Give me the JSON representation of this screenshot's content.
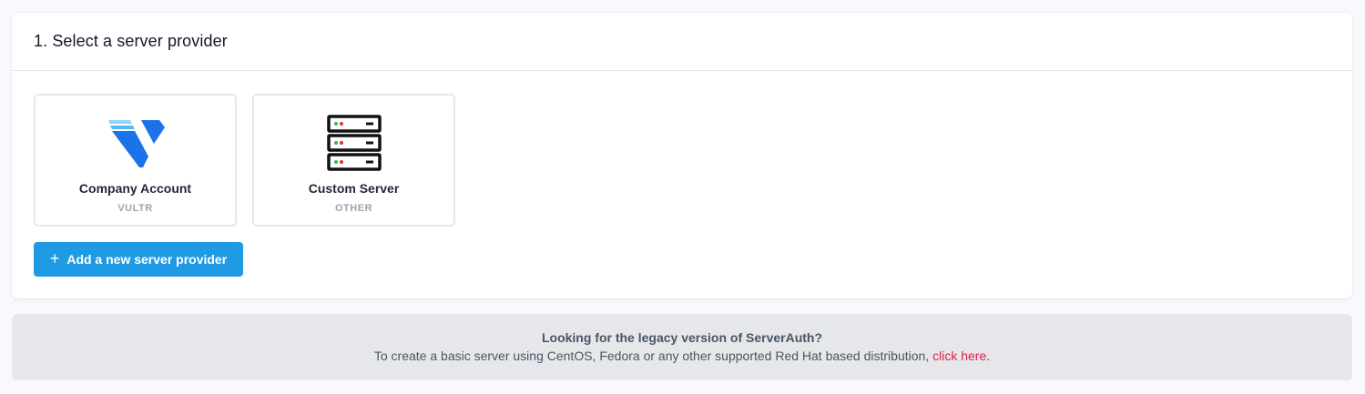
{
  "section": {
    "title": "1. Select a server provider"
  },
  "providers": [
    {
      "name": "Company Account",
      "type": "VULTR",
      "icon": "vultr-logo-icon"
    },
    {
      "name": "Custom Server",
      "type": "OTHER",
      "icon": "server-rack-icon"
    }
  ],
  "add_provider": {
    "icon": "plus-icon",
    "label": "Add a new server provider"
  },
  "legacy_notice": {
    "heading": "Looking for the legacy version of ServerAuth?",
    "body": "To create a basic server using CentOS, Fedora or any other supported Red Hat based distribution, ",
    "link_text": "click here",
    "trailing": "."
  },
  "colors": {
    "primary_button": "#1f9be6",
    "link": "#e11d48",
    "vultr_blue": "#1a73e8",
    "vultr_light_blue": "#51b9ff"
  }
}
